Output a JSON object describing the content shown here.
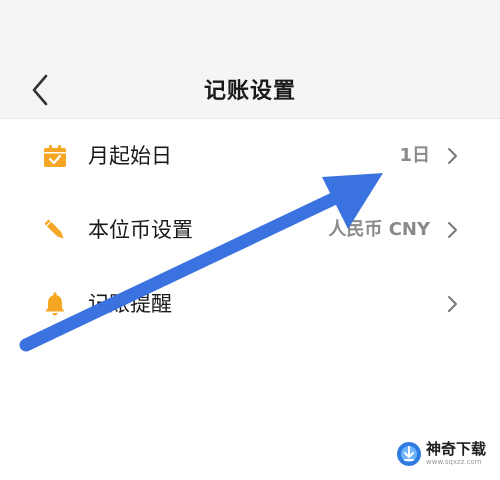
{
  "header": {
    "title": "记账设置",
    "back_icon": "chevron-left-icon"
  },
  "settings": [
    {
      "id": "month-start-day",
      "icon": "calendar-icon",
      "icon_color": "#f5a623",
      "label": "月起始日",
      "value": "1日"
    },
    {
      "id": "base-currency",
      "icon": "pencil-icon",
      "icon_color": "#f5a623",
      "label": "本位币设置",
      "value": "人民币 CNY"
    },
    {
      "id": "bookkeeping-reminder",
      "icon": "bell-icon",
      "icon_color": "#f5a623",
      "label": "记账提醒",
      "value": ""
    }
  ],
  "annotation": {
    "type": "arrow",
    "color": "#3a72e0"
  },
  "watermark": {
    "title": "神奇下载",
    "url": "www.sqxzz.com",
    "icon": "download-logo-icon"
  }
}
